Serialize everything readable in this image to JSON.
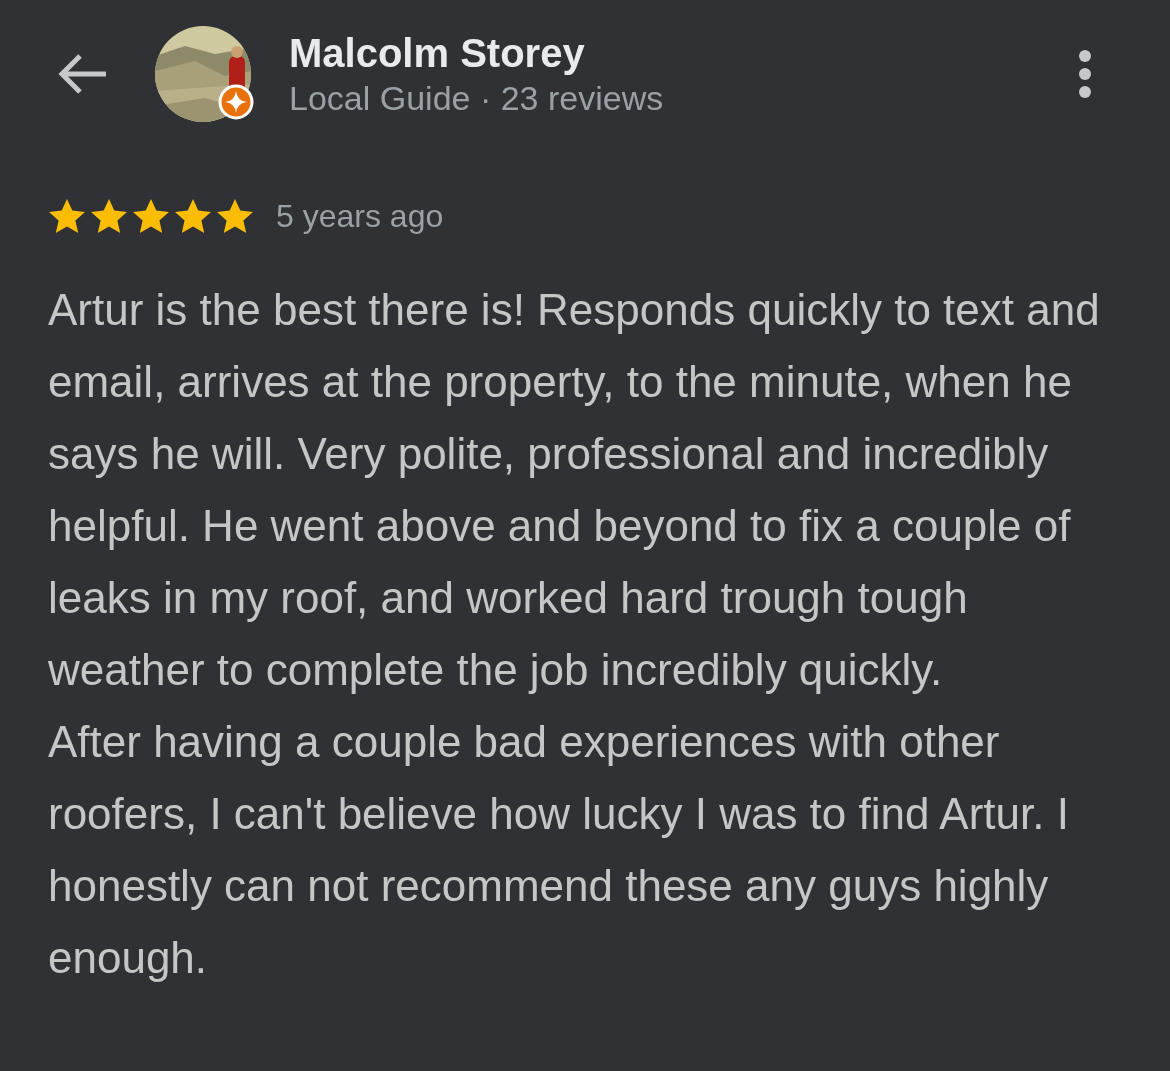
{
  "header": {
    "reviewer_name": "Malcolm Storey",
    "reviewer_info": "Local Guide · 23 reviews",
    "local_guide": true
  },
  "review": {
    "stars": 5,
    "time": "5 years ago",
    "paragraphs": [
      "Artur is the best there is! Responds quickly to text and email, arrives at the property, to the minute, when he says he will. Very polite, professional and incredibly helpful. He went above and beyond to fix a couple of leaks in my roof, and worked hard trough tough weather to complete the job incredibly quickly.",
      "After having a couple bad experiences with other roofers, I can't believe how lucky I was to find Artur. I honestly can not recommend these any guys highly enough."
    ]
  }
}
